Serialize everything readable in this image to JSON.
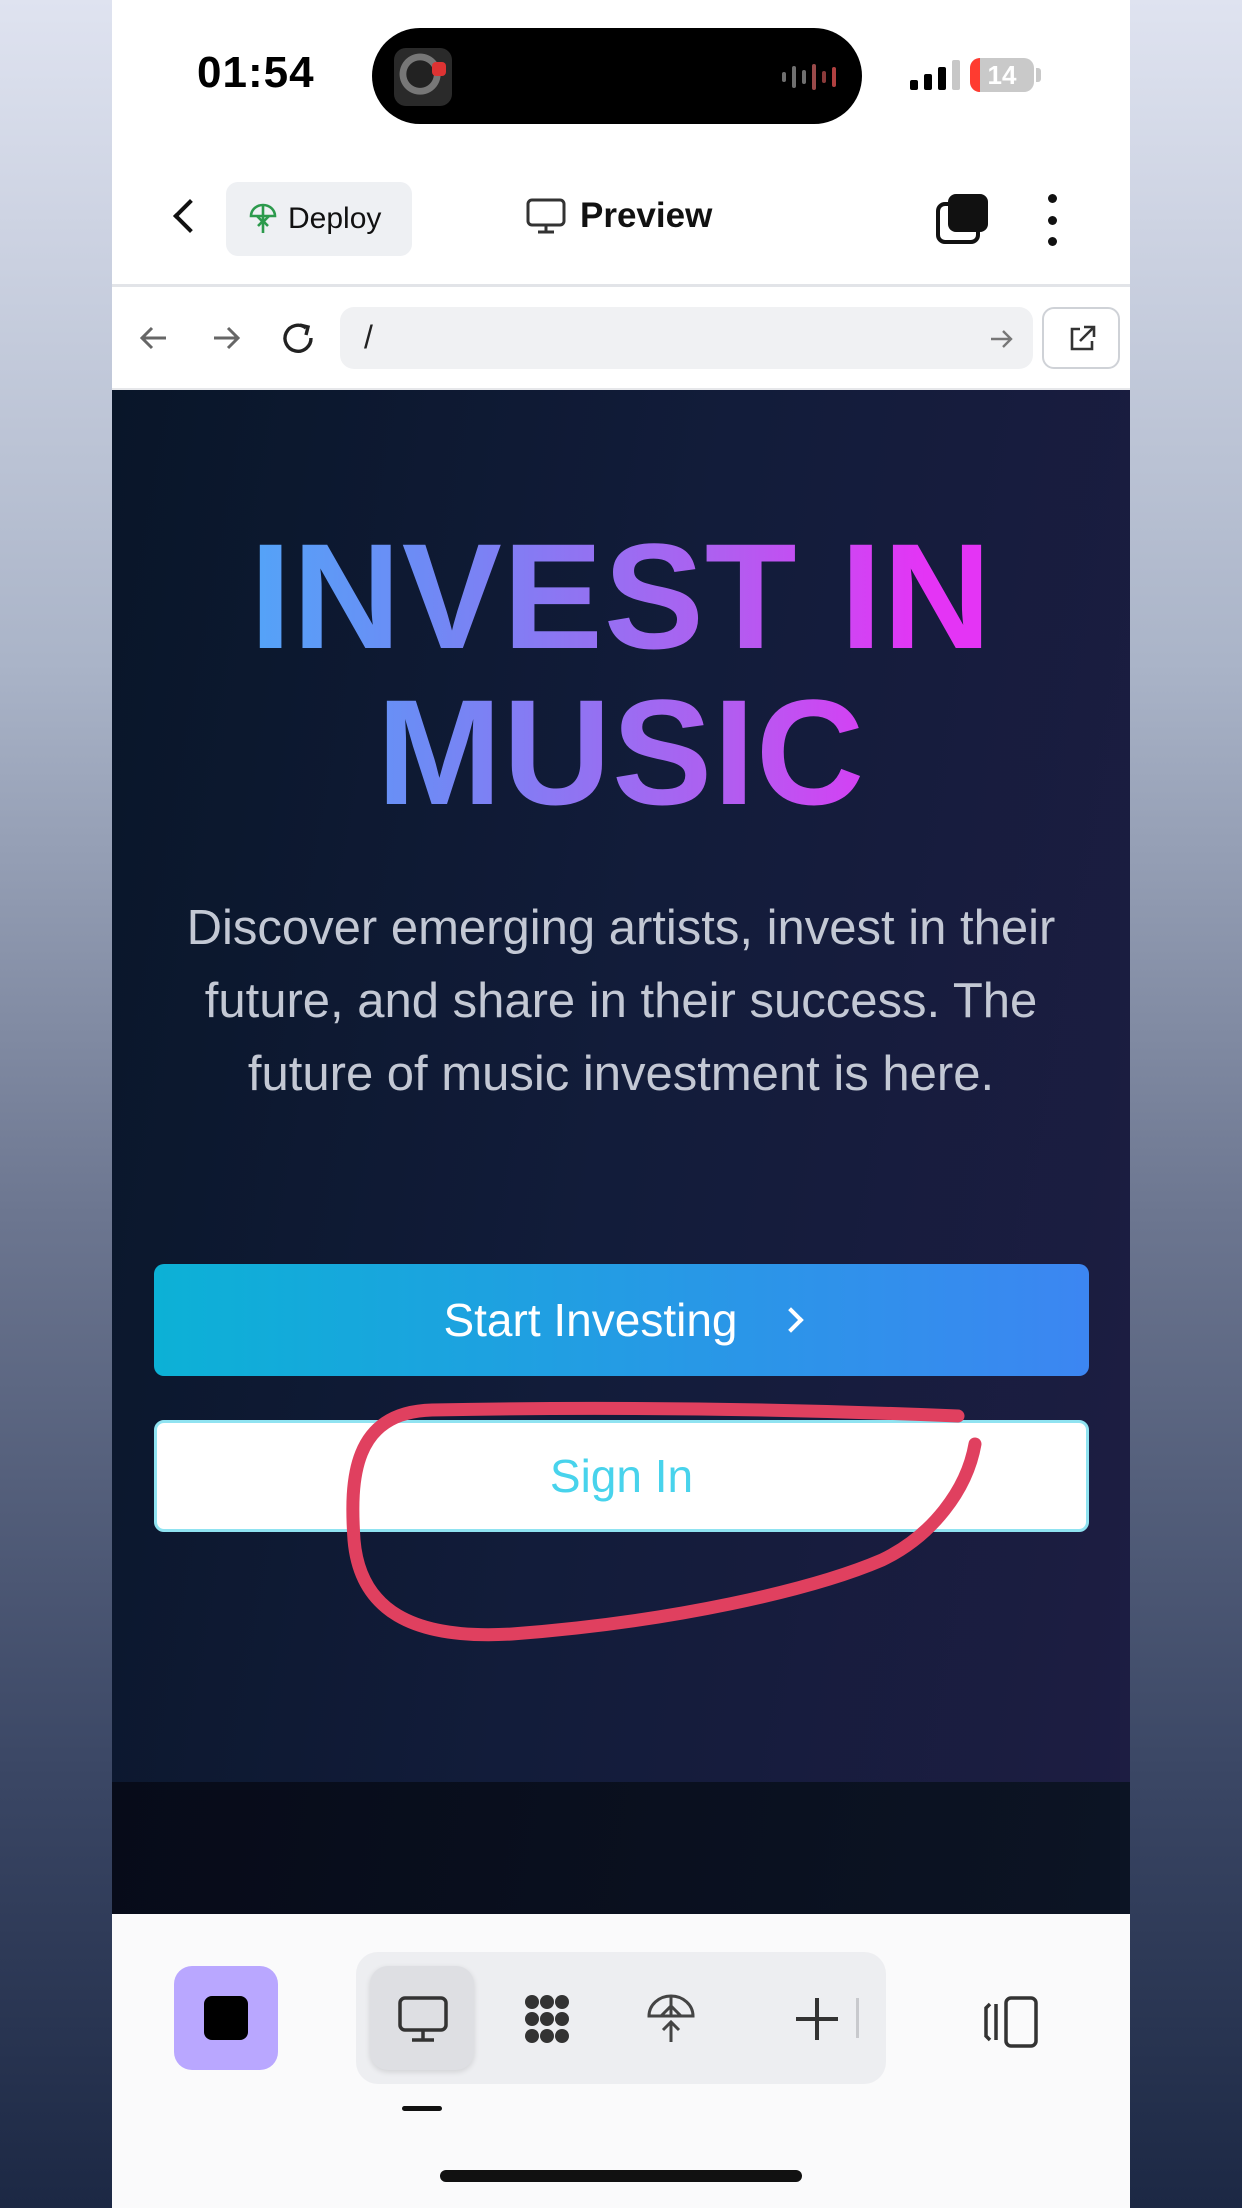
{
  "status_bar": {
    "time": "01:54",
    "battery": "14",
    "icons": [
      "music-thumbnail-icon",
      "audio-wave-icon",
      "signal-icon",
      "battery-icon"
    ]
  },
  "header": {
    "deploy_label": "Deploy",
    "preview_label": "Preview",
    "icons": [
      "back-icon",
      "deploy-icon",
      "monitor-icon",
      "tabs-icon",
      "more-icon"
    ]
  },
  "browser": {
    "url": "/",
    "icons": [
      "nav-back-icon",
      "nav-forward-icon",
      "reload-icon",
      "go-arrow-icon",
      "open-external-icon"
    ]
  },
  "hero": {
    "title_line1": "INVEST IN",
    "title_line2": "MUSIC",
    "subtitle": "Discover emerging artists, invest in their future, and share in their success. The future of music investment is here.",
    "primary_button": "Start Investing",
    "secondary_button": "Sign In"
  },
  "annotation": {
    "color": "#e0405f",
    "shape": "hand-drawn circle around Sign In"
  },
  "toolbar": {
    "accent": "#b9a7ff",
    "icons": [
      "stop-icon",
      "monitor-icon",
      "grid-blob-icon",
      "deploy-icon",
      "plus-icon",
      "split-view-icon"
    ]
  },
  "colors": {
    "gradient_start": "#3eb8fa",
    "gradient_end": "#e434f5",
    "invest_btn_start": "#0cb1d6",
    "invest_btn_end": "#3c86f2",
    "signin_text": "#48d3ec"
  }
}
